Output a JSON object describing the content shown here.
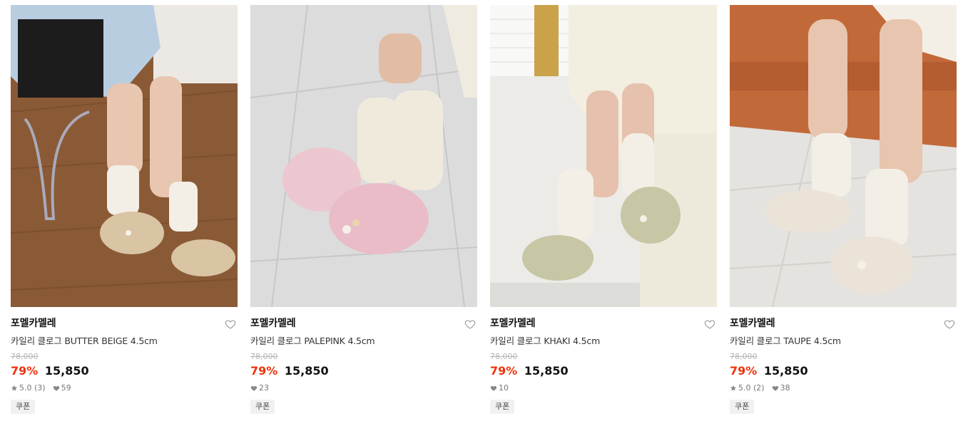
{
  "products": [
    {
      "brand": "포멜카멜레",
      "name": "카일리 클로그 BUTTER BEIGE 4.5cm",
      "original_price": "78,000",
      "discount": "79%",
      "price": "15,850",
      "rating": "5.0",
      "review_count": "(3)",
      "likes": "59",
      "badge": "쿠폰",
      "color": "#d9c4a4"
    },
    {
      "brand": "포멜카멜레",
      "name": "카일리 클로그 PALEPINK 4.5cm",
      "original_price": "78,000",
      "discount": "79%",
      "price": "15,850",
      "rating": "",
      "review_count": "",
      "likes": "23",
      "badge": "쿠폰",
      "color": "#ecc7d0"
    },
    {
      "brand": "포멜카멜레",
      "name": "카일리 클로그 KHAKI 4.5cm",
      "original_price": "78,000",
      "discount": "79%",
      "price": "15,850",
      "rating": "",
      "review_count": "",
      "likes": "10",
      "badge": "쿠폰",
      "color": "#c7c6a5"
    },
    {
      "brand": "포멜카멜레",
      "name": "카일리 클로그 TAUPE 4.5cm",
      "original_price": "78,000",
      "discount": "79%",
      "price": "15,850",
      "rating": "5.0",
      "review_count": "(2)",
      "likes": "38",
      "badge": "쿠폰",
      "color": "#ebe3d8"
    }
  ],
  "icons": {
    "wishlist": "heart-outline-icon",
    "rating": "star-icon",
    "likes": "heart-filled-icon"
  },
  "colors": {
    "discount": "#f0320a",
    "price": "#111111",
    "original_price": "#b5b5b5",
    "badge_bg": "#f1f1f1"
  }
}
